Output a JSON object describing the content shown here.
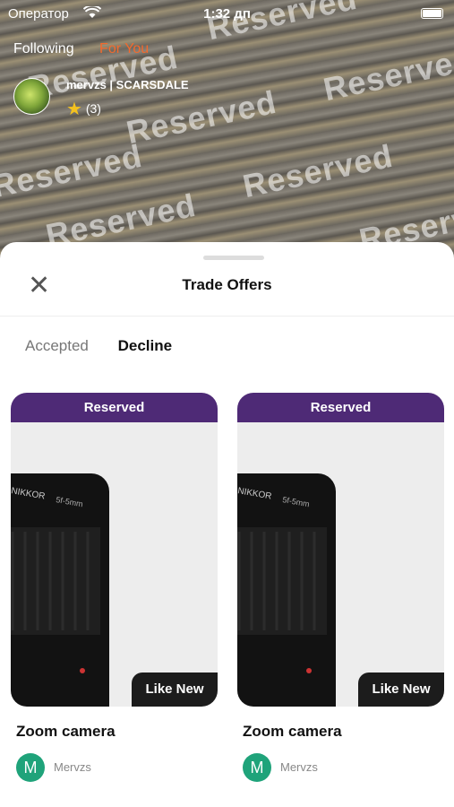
{
  "status_bar": {
    "carrier": "Оператор",
    "time": "1:32 дп"
  },
  "feed_tabs": {
    "following": "Following",
    "for_you": "For You"
  },
  "seller": {
    "name": "mervzs | SCARSDALE",
    "rating_count": "(3)"
  },
  "watermark": "Reserved",
  "sheet": {
    "title": "Trade Offers"
  },
  "tabs": [
    {
      "label": "Accepted"
    },
    {
      "label": "Decline"
    }
  ],
  "cards": [
    {
      "banner": "Reserved",
      "lens_text": "NIKKOR",
      "lens_sub": "5f-5mm",
      "condition": "Like New",
      "title": "Zoom camera",
      "owner_initial": "M",
      "owner_name": "Mervzs"
    },
    {
      "banner": "Reserved",
      "lens_text": "NIKKOR",
      "lens_sub": "5f-5mm",
      "condition": "Like New",
      "title": "Zoom camera",
      "owner_initial": "M",
      "owner_name": "Mervzs"
    }
  ],
  "colors": {
    "accent": "#f26a2e",
    "banner": "#4e2a76",
    "avatar": "#1fa37a"
  }
}
